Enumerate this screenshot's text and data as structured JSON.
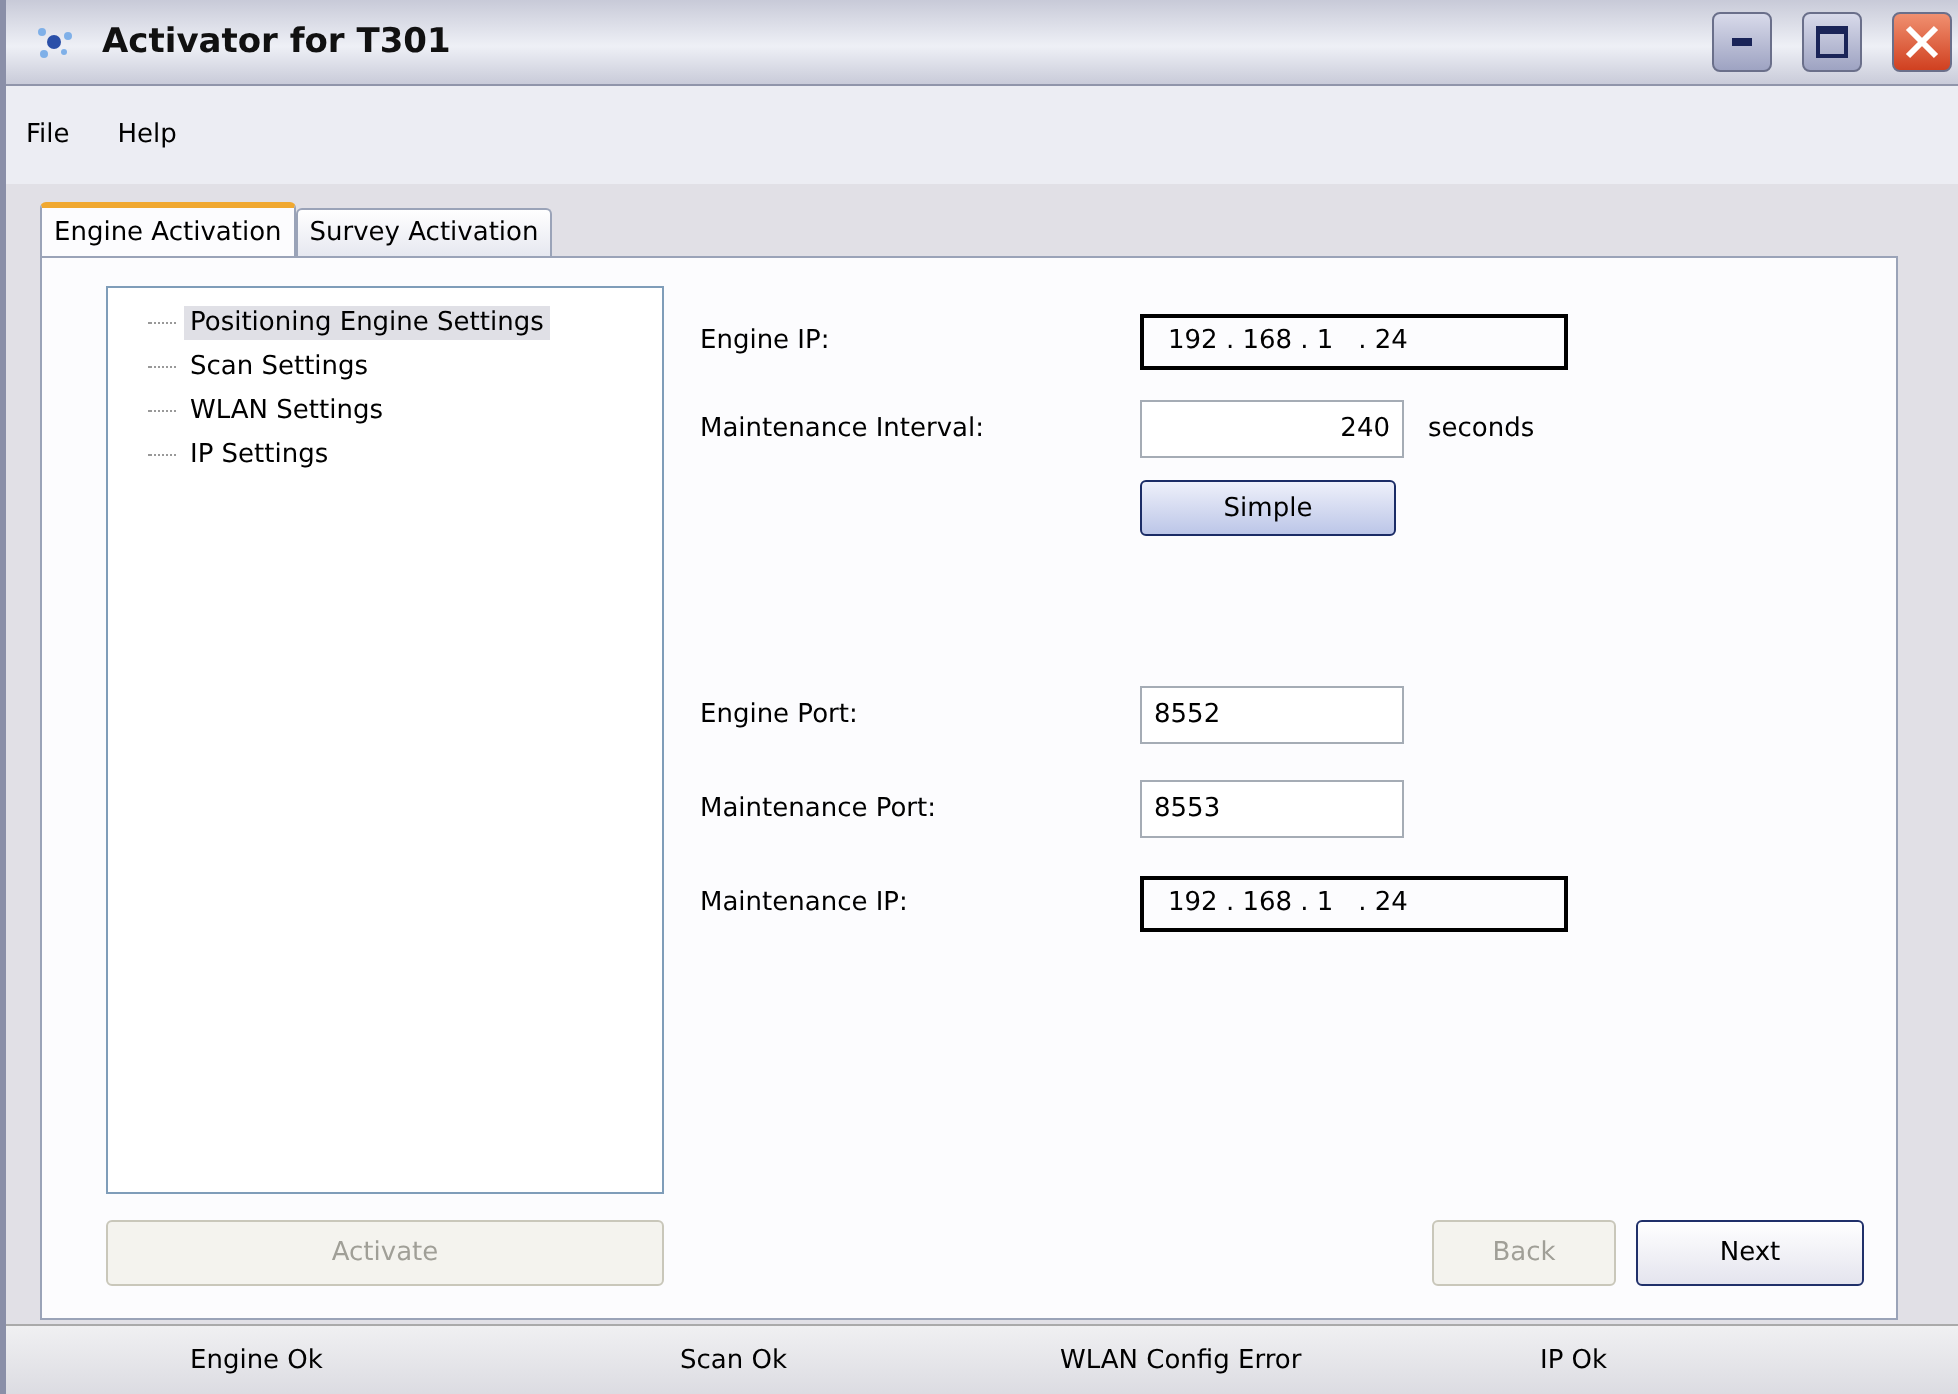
{
  "window": {
    "title": "Activator for T301"
  },
  "menu": [
    "File",
    "Help"
  ],
  "tabs": [
    {
      "label": "Engine Activation",
      "selected": true
    },
    {
      "label": "Survey Activation",
      "selected": false
    }
  ],
  "tree": [
    {
      "label": "Positioning Engine Settings",
      "selected": true
    },
    {
      "label": "Scan Settings",
      "selected": false
    },
    {
      "label": "WLAN Settings",
      "selected": false
    },
    {
      "label": "IP Settings",
      "selected": false
    }
  ],
  "activate_button": {
    "label": "Activate",
    "disabled": true
  },
  "fields": [
    {
      "kind": "ip",
      "label": "Engine IP:",
      "value": "192 . 168 . 1   . 24"
    },
    {
      "kind": "number",
      "label": "Maintenance Interval:",
      "value": "240",
      "unit": "seconds"
    },
    {
      "kind": "button",
      "label": "Simple"
    },
    {
      "kind": "spacer"
    },
    {
      "kind": "text",
      "label": "Engine Port:",
      "value": "8552"
    },
    {
      "kind": "text",
      "label": "Maintenance Port:",
      "value": "8553"
    },
    {
      "kind": "ip",
      "label": "Maintenance IP:",
      "value": "192 . 168 . 1   . 24"
    }
  ],
  "nav_buttons": [
    {
      "label": "Back",
      "disabled": true
    },
    {
      "label": "Next",
      "disabled": false
    }
  ],
  "status_bar": [
    "Engine Ok",
    "Scan Ok",
    "WLAN Config Error",
    "IP Ok"
  ]
}
